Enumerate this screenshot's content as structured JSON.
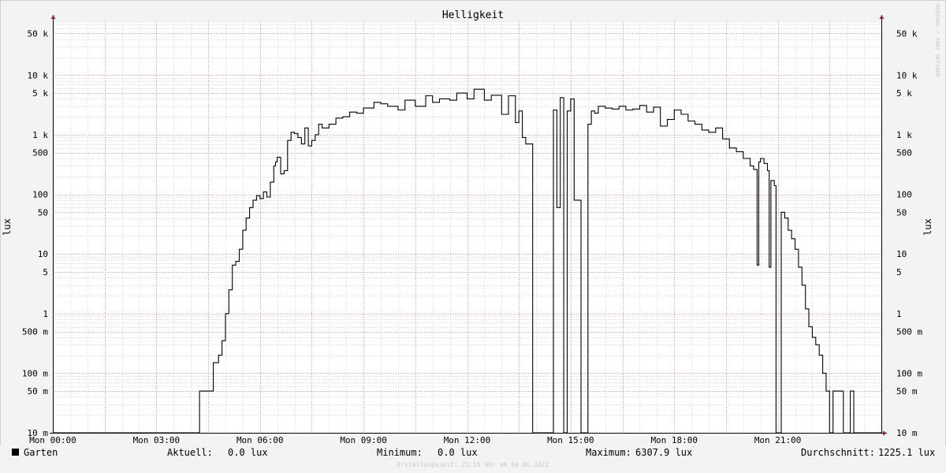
{
  "chart_data": {
    "type": "line",
    "title": "Helligkeit",
    "ylabel": "lux",
    "yscale": "log",
    "ylim": [
      0.01,
      80000
    ],
    "xlim_hours": [
      0,
      24
    ],
    "x_ticks": [
      "Mon 00:00",
      "Mon 03:00",
      "Mon 06:00",
      "Mon 09:00",
      "Mon 12:00",
      "Mon 15:00",
      "Mon 18:00",
      "Mon 21:00"
    ],
    "x_tick_hours": [
      0,
      3,
      6,
      9,
      12,
      15,
      18,
      21
    ],
    "y_ticks": [
      "10 m",
      "50 m",
      "100 m",
      "500 m",
      "1",
      "5",
      "10",
      "50",
      "100",
      "500",
      "1 k",
      "5 k",
      "10 k",
      "50 k"
    ],
    "y_tick_values": [
      0.01,
      0.05,
      0.1,
      0.5,
      1,
      5,
      10,
      50,
      100,
      500,
      1000,
      5000,
      10000,
      50000
    ],
    "grid": true,
    "watermark": "RRDTOOL / TOBI OETIKER",
    "series": [
      {
        "name": "Garten",
        "color": "#000000",
        "x_hours": [
          0,
          4.2,
          4.25,
          4.6,
          4.65,
          4.8,
          4.9,
          5.0,
          5.1,
          5.2,
          5.3,
          5.4,
          5.5,
          5.6,
          5.7,
          5.8,
          5.9,
          6.0,
          6.1,
          6.2,
          6.3,
          6.4,
          6.45,
          6.5,
          6.6,
          6.7,
          6.8,
          6.9,
          7.0,
          7.1,
          7.2,
          7.3,
          7.4,
          7.5,
          7.6,
          7.7,
          7.8,
          8.0,
          8.2,
          8.4,
          8.6,
          8.8,
          9.0,
          9.3,
          9.5,
          9.7,
          10.0,
          10.2,
          10.5,
          10.8,
          11.0,
          11.2,
          11.5,
          11.7,
          12.0,
          12.2,
          12.5,
          12.7,
          13.0,
          13.2,
          13.4,
          13.5,
          13.6,
          13.7,
          13.9,
          14.0,
          14.05,
          14.1,
          14.5,
          14.6,
          14.7,
          14.8,
          14.85,
          14.9,
          15.0,
          15.1,
          15.3,
          15.4,
          15.5,
          15.6,
          15.7,
          15.8,
          16.0,
          16.2,
          16.4,
          16.6,
          16.8,
          17.0,
          17.2,
          17.4,
          17.6,
          17.8,
          18.0,
          18.2,
          18.4,
          18.6,
          18.8,
          19.0,
          19.2,
          19.4,
          19.6,
          19.8,
          20.0,
          20.2,
          20.3,
          20.4,
          20.45,
          20.5,
          20.6,
          20.7,
          20.75,
          20.8,
          20.9,
          20.95,
          21.0,
          21.05,
          21.1,
          21.2,
          21.3,
          21.4,
          21.5,
          21.6,
          21.7,
          21.8,
          21.9,
          22.0,
          22.1,
          22.2,
          22.3,
          22.4,
          22.5,
          22.55,
          22.6,
          22.9,
          23.0,
          23.1,
          23.2,
          23.3,
          24.0
        ],
        "values": [
          0.01,
          0.01,
          0.05,
          0.05,
          0.15,
          0.2,
          0.35,
          1.0,
          2.5,
          6.5,
          7.5,
          12,
          25,
          40,
          60,
          80,
          95,
          85,
          110,
          90,
          160,
          300,
          350,
          420,
          220,
          250,
          800,
          1100,
          1050,
          900,
          700,
          1300,
          650,
          800,
          1000,
          1500,
          1300,
          1500,
          1900,
          2000,
          2400,
          2300,
          2800,
          3500,
          3300,
          3000,
          2600,
          3800,
          3000,
          4500,
          3500,
          4000,
          3800,
          5000,
          4000,
          5800,
          3800,
          4600,
          2200,
          4500,
          1600,
          2500,
          900,
          700,
          0.01,
          0.01,
          0.01,
          0.01,
          2600,
          60,
          4200,
          0.01,
          0.01,
          2500,
          4000,
          80,
          0.01,
          0.01,
          1500,
          2500,
          2300,
          3000,
          2800,
          2700,
          3000,
          2600,
          2700,
          3100,
          2400,
          2900,
          1400,
          1800,
          2600,
          2200,
          1700,
          1500,
          1200,
          1100,
          1300,
          850,
          600,
          520,
          400,
          300,
          260,
          6.5,
          350,
          400,
          330,
          250,
          6.0,
          170,
          140,
          0.01,
          0.01,
          0.01,
          50,
          40,
          25,
          18,
          12,
          6,
          3,
          1.2,
          0.6,
          0.4,
          0.3,
          0.2,
          0.1,
          0.05,
          0.01,
          0.01,
          0.05,
          0.01,
          0.01,
          0.05,
          0.01,
          0.01
        ]
      }
    ],
    "legend": {
      "label": "Garten",
      "current_label": "Aktuell:",
      "current_value": "0.0 lux",
      "min_label": "Minimum:",
      "min_value": "0.0 lux",
      "max_label": "Maximum:",
      "max_value": "6307.9 lux",
      "avg_label": "Durchschnitt:",
      "avg_value": "1225.1 lux"
    },
    "footer": "Erstellungszeit: 23:55 Uhr am 06.06.2022"
  }
}
